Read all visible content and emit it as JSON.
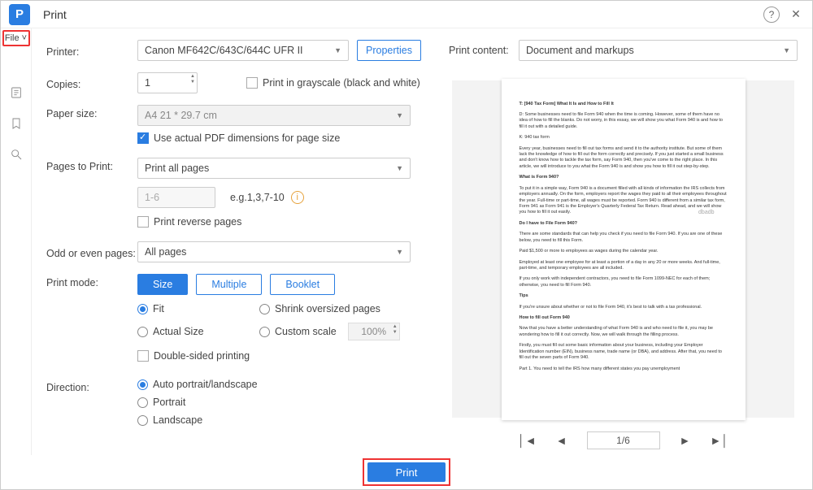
{
  "window": {
    "title": "Print"
  },
  "sidebar": {
    "file_label": "File ˅"
  },
  "form": {
    "printer_label": "Printer:",
    "printer_value": "Canon MF642C/643C/644C UFR II",
    "properties_btn": "Properties",
    "copies_label": "Copies:",
    "copies_value": "1",
    "grayscale_label": "Print in grayscale (black and white)",
    "paper_label": "Paper size:",
    "paper_value": "A4 21 * 29.7 cm",
    "use_actual_dims": "Use actual PDF dimensions for page size",
    "pages_to_print_label": "Pages to Print:",
    "pages_mode": "Print all pages",
    "range_placeholder": "1-6",
    "range_example": "e.g.1,3,7-10",
    "reverse_label": "Print reverse pages",
    "odd_even_label": "Odd or even pages:",
    "odd_even_value": "All pages",
    "print_mode_label": "Print mode:",
    "seg": {
      "size": "Size",
      "multiple": "Multiple",
      "booklet": "Booklet"
    },
    "radios": {
      "fit": "Fit",
      "shrink": "Shrink oversized pages",
      "actual": "Actual Size",
      "custom": "Custom scale",
      "custom_value": "100%"
    },
    "double_sided": "Double-sided printing",
    "direction_label": "Direction:",
    "direction": {
      "auto": "Auto portrait/landscape",
      "portrait": "Portrait",
      "landscape": "Landscape"
    }
  },
  "right": {
    "content_label": "Print content:",
    "content_value": "Document and markups",
    "page_indicator": "1/6",
    "watermark": "dbadb"
  },
  "preview_text": {
    "p1": "T: [940 Tax Form] What It Is and How to Fill It",
    "p2": "D: Some businesses need to file Form 940 when the time is coming. However, some of them have no idea of how to fill the blanks. Do not worry, in this essay, we will show you what Form 940 is and how to fill it out with a detailed guide.",
    "p3": "K: 940 tax form",
    "p4": "Every year, businesses need to fill out tax forms and send it to the authority institute. But some of them lack the knowledge of how to fill out the form correctly and precisely. If you just started a small business and don't know how to tackle the tax form, say Form 940, then you've come to the right place. In this article, we will introduce to you what the Form 940 is and show you how to fill it out step-by-step.",
    "p5": "What is Form 940?",
    "p6": "To put it in a simple way, Form 940 is a document filled with all kinds of information the IRS collects from employers annually. On the form, employers report the wages they paid to all their employees throughout the year. Full-time or part-time, all wages must be reported. Form 940 is different from a similar tax form, Form 941 as Form 941 is the Employer's Quarterly Federal Tax Return. Read ahead, and we will show you how to fill it out easily.",
    "p7": "Do I have to File Form 940?",
    "p8": "There are some standards that can help you check if you need to file Form 940. If you are one of these below, you need to fill this Form.",
    "p9": "Paid $1,500 or more to employees as wages during the calendar year.",
    "p10": "Employed at least one employee for at least a portion of a day in any 20 or more weeks. And full-time, part-time, and temporary employees are all included.",
    "p11": "If you only work with independent contractors, you need to file Form 1099-NEC for each of them; otherwise, you need to fill Form 940.",
    "p12": "Tips",
    "p13": "If you're unsure about whether or not to file Form 940, it's best to talk with a tax professional.",
    "p14": "How to fill out Form 940",
    "p15": "Now that you have a better understanding of what Form 940 is and who need to file it, you may be wondering how to fill it out correctly. Now, we will walk through the filling process.",
    "p16": "Firstly, you must fill out some basic information about your business, including your Employer Identification number (EIN), business name, trade name (or DBA), and address. After that, you need to fill out the seven parts of Form 940.",
    "p17": "Part 1. You need to tell the IRS how many different states you pay unemployment"
  },
  "footer": {
    "print_btn": "Print"
  }
}
